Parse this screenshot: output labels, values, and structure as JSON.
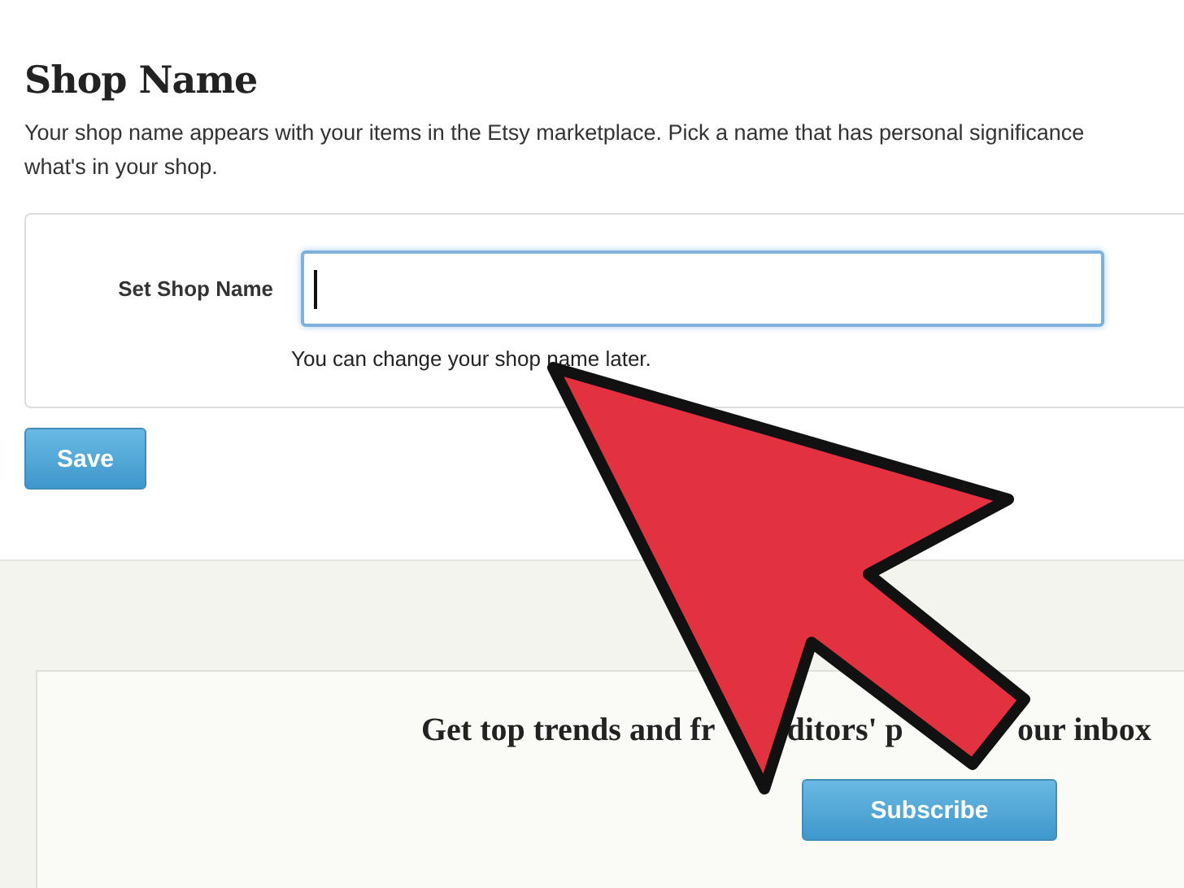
{
  "section": {
    "title": "Shop Name",
    "description_lines": [
      "Your shop name appears with your items in the Etsy marketplace. Pick a name that has personal significance",
      "what's in your shop."
    ]
  },
  "form": {
    "label": "Set Shop Name",
    "hint": "You can change your shop name later."
  },
  "save_button": "Save",
  "newsletter": {
    "heading_parts": [
      "Get top trends and fr",
      "ditors' p",
      "our inbox"
    ],
    "button": "Subscribe"
  }
}
